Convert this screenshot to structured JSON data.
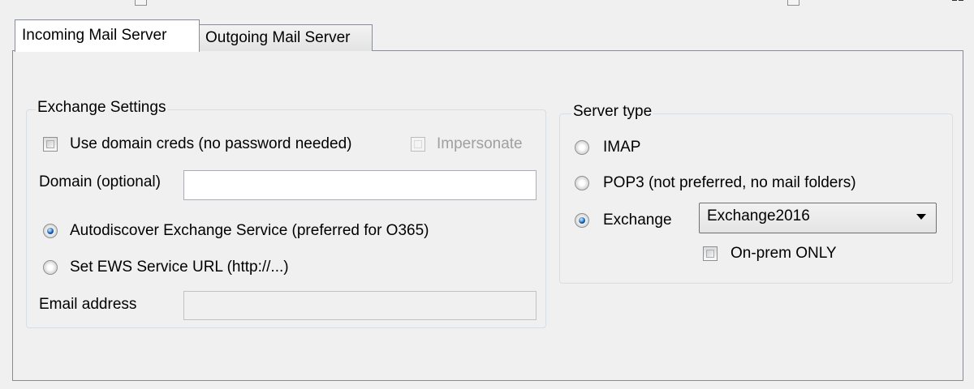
{
  "tabs": [
    {
      "label": "Incoming Mail Server",
      "active": true
    },
    {
      "label": "Outgoing Mail Server",
      "active": false
    }
  ],
  "exchange_settings": {
    "title": "Exchange Settings",
    "use_domain_creds": {
      "label": "Use domain creds (no password needed)",
      "checked": false
    },
    "impersonate": {
      "label": "Impersonate",
      "checked": false,
      "enabled": false
    },
    "domain": {
      "label": "Domain (optional)",
      "value": ""
    },
    "autodiscover": {
      "label": "Autodiscover Exchange Service (preferred for O365)",
      "selected": true
    },
    "set_ews_url": {
      "label": "Set EWS Service URL (http://...)",
      "selected": false
    },
    "email_address": {
      "label": "Email address",
      "value": "",
      "enabled": false
    }
  },
  "server_type": {
    "title": "Server type",
    "imap": {
      "label": "IMAP",
      "selected": false
    },
    "pop3": {
      "label": "POP3 (not preferred, no mail folders)",
      "selected": false
    },
    "exchange": {
      "label": "Exchange",
      "selected": true
    },
    "exchange_version": {
      "value": "Exchange2016"
    },
    "on_prem_only": {
      "label": "On-prem ONLY",
      "checked": false
    }
  },
  "icons": [
    "checkbox-icon",
    "radio-icon",
    "dropdown-arrow-icon"
  ],
  "colors": {
    "window_bg": "#f0f0f0",
    "tab_border": "#898c95",
    "radio_selected": "#1e5fa8",
    "disabled_text": "#a0a0a0"
  }
}
